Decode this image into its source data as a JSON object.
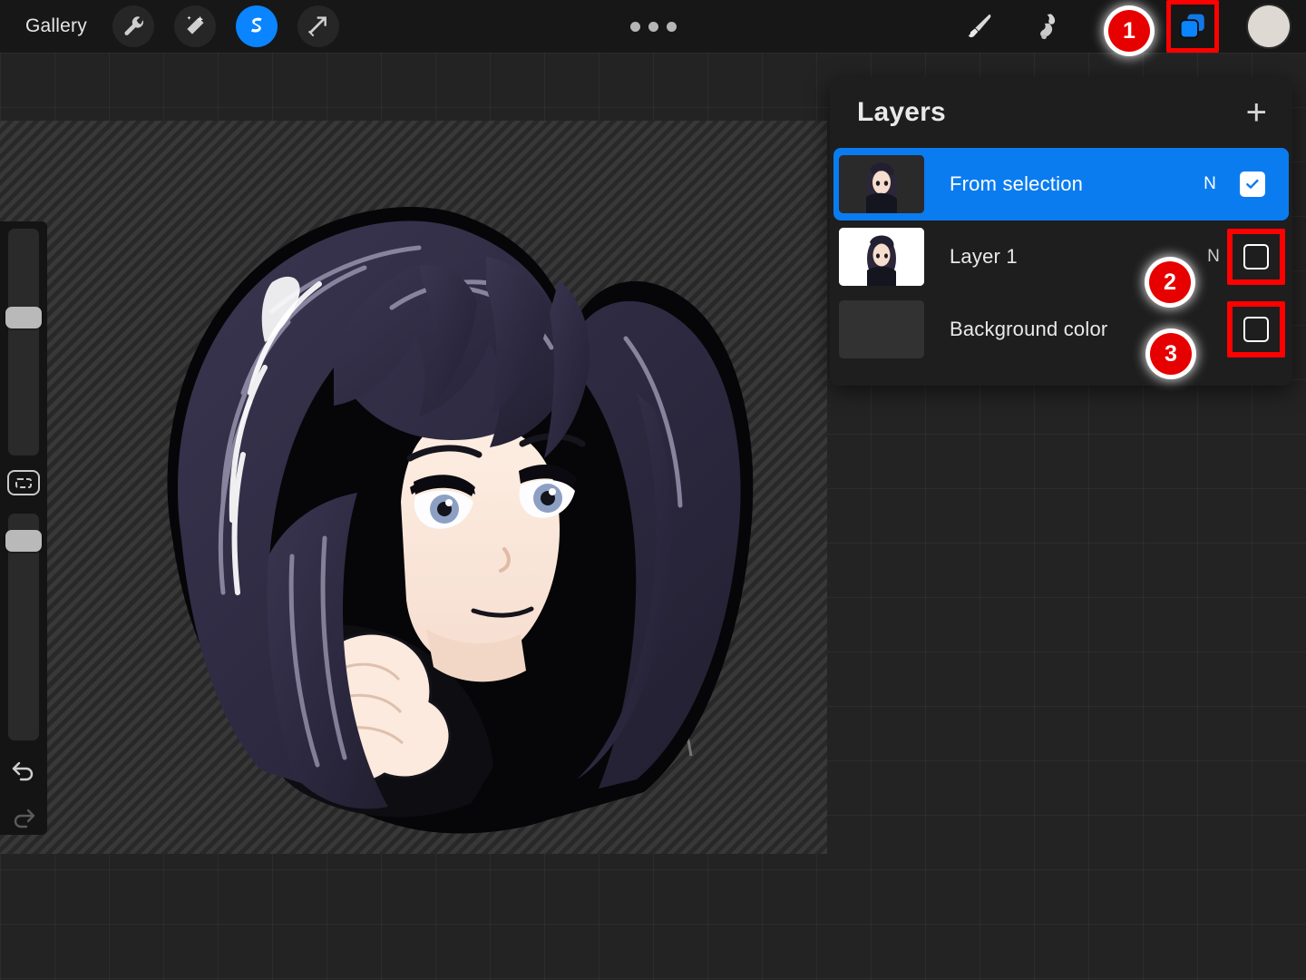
{
  "app": {
    "name": "Procreate",
    "accent_blue": "#0a84ff",
    "panel_bg": "#1e1e1e",
    "selected_row_blue": "#0a7cf0",
    "highlight_red": "#ff0000",
    "badge_red": "#e60000"
  },
  "toolbar": {
    "gallery_label": "Gallery",
    "icons": {
      "wrench": "wrench-icon",
      "wand": "magic-wand-icon",
      "selection": "selection-s-icon",
      "transform": "transform-arrow-icon",
      "overflow": "more-options-icon",
      "brush": "paintbrush-icon",
      "smudge": "smudge-icon",
      "eraser": "eraser-icon",
      "layers": "layers-icon",
      "color": "color-swatch-icon"
    }
  },
  "sidebar": {
    "brush_size_label": "brush-size-slider",
    "brush_size_percent": 62,
    "modify_label": "modify-button",
    "opacity_label": "opacity-slider",
    "opacity_percent": 92,
    "undo_label": "undo-button",
    "redo_label": "redo-button"
  },
  "layers_panel": {
    "title": "Layers",
    "add_label": "+",
    "rows": [
      {
        "name": "From selection",
        "blend_mode": "N",
        "visible": true,
        "selected": true,
        "thumbnail": "character-on-transparent",
        "highlighted": false
      },
      {
        "name": "Layer 1",
        "blend_mode": "N",
        "visible": false,
        "selected": false,
        "thumbnail": "character-on-white",
        "highlighted": true
      },
      {
        "name": "Background color",
        "blend_mode": "",
        "visible": false,
        "selected": false,
        "thumbnail": "solid-dark-gray",
        "highlighted": true
      }
    ]
  },
  "annotations": [
    {
      "number": "1",
      "target": "layers-button"
    },
    {
      "number": "2",
      "target": "layer-1-visibility-checkbox"
    },
    {
      "number": "3",
      "target": "background-color-visibility-checkbox"
    }
  ],
  "canvas": {
    "artwork_description": "anime girl with long dark hair resting chin on hand",
    "background": "transparency-diagonal-stripes"
  }
}
